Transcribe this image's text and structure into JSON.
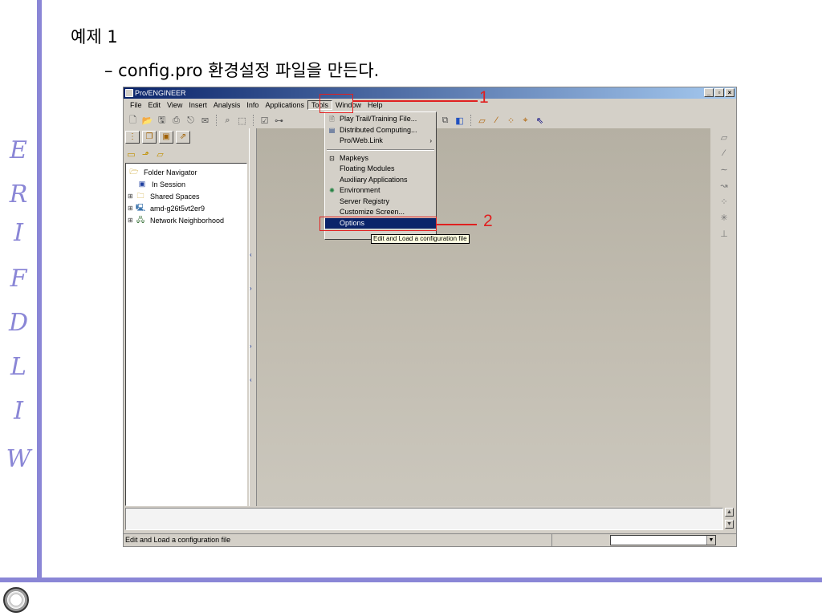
{
  "sidebar": {
    "watermark_letters": [
      "W",
      "I",
      "L",
      "D",
      "F",
      "I",
      "R",
      "E"
    ]
  },
  "slide": {
    "title": "예제 1",
    "bullet": "– config.pro 환경설정 파일을 만든다."
  },
  "window": {
    "title": "Pro/ENGINEER",
    "buttons": [
      "_",
      "▫",
      "×"
    ]
  },
  "menubar": {
    "items": [
      "File",
      "Edit",
      "View",
      "Insert",
      "Analysis",
      "Info",
      "Applications",
      "Tools",
      "Window",
      "Help"
    ],
    "open_item": "Tools"
  },
  "navigator": {
    "tree": [
      "Folder Navigator",
      "In Session",
      "Shared Spaces",
      "amd-g26t5vt2er9",
      "Network Neighborhood"
    ]
  },
  "tools_menu": {
    "items": [
      {
        "label": "Play Trail/Training File...",
        "icon": "play-trail-icon"
      },
      {
        "label": "Distributed Computing...",
        "icon": "distributed-icon"
      },
      {
        "label": "Pro/Web.Link",
        "icon": "",
        "submenu": true
      },
      {
        "label": "Mapkeys",
        "icon": "mapkeys-icon"
      },
      {
        "label": "Floating Modules",
        "icon": ""
      },
      {
        "label": "Auxiliary Applications",
        "icon": ""
      },
      {
        "label": "Environment",
        "icon": "environment-icon"
      },
      {
        "label": "Server Registry",
        "icon": ""
      },
      {
        "label": "Customize Screen...",
        "icon": ""
      },
      {
        "label": "Options",
        "icon": "",
        "highlighted": true
      }
    ],
    "submenu_arrow": "›"
  },
  "tooltip": "Edit and Load a configuration file",
  "statusbar": {
    "text": "Edit and Load a configuration file"
  },
  "annotations": {
    "step1": "1",
    "step2": "2"
  },
  "colors": {
    "accent_stripe": "#8a86d6",
    "annotation_red": "#e02020",
    "menu_highlight": "#0a246a"
  }
}
